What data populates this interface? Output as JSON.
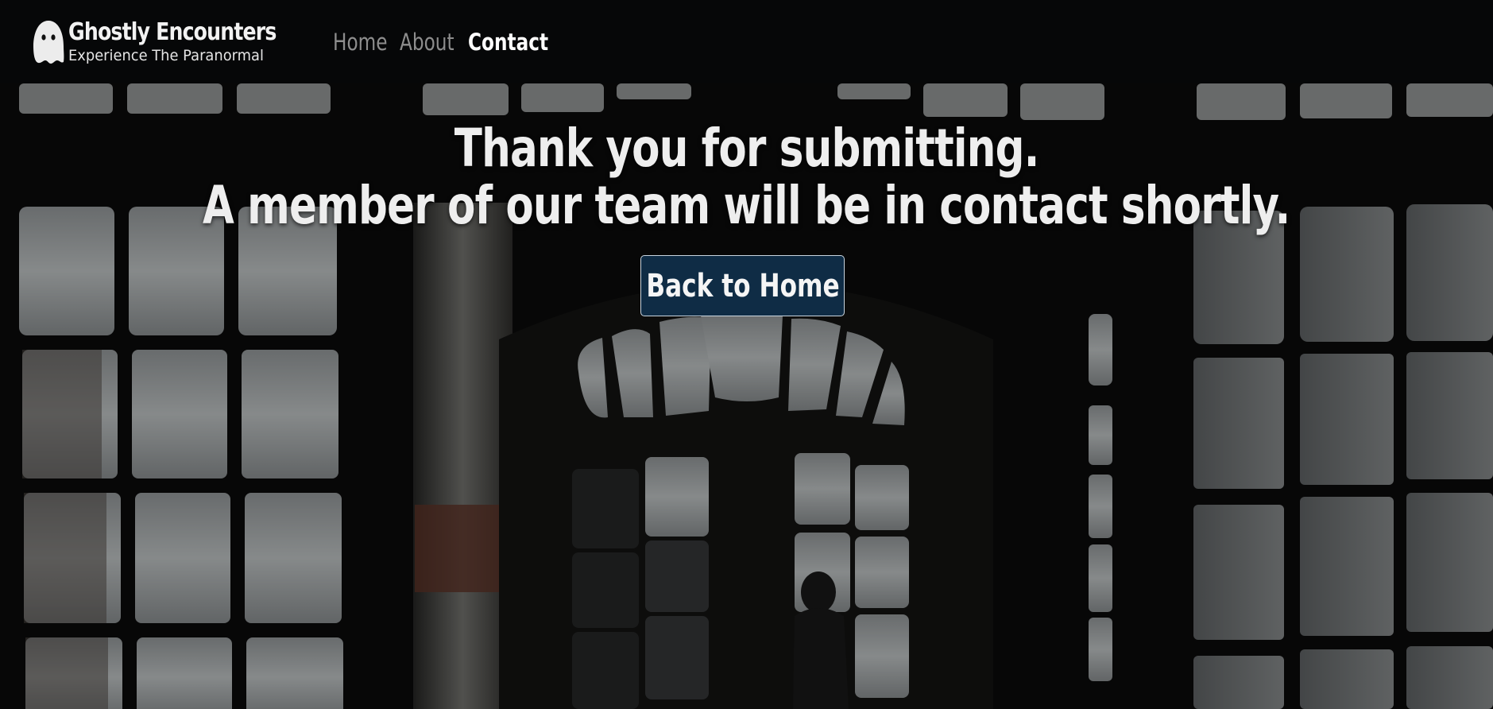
{
  "header": {
    "brand": {
      "title": "Ghostly Encounters",
      "subtitle": "Experience The Paranormal",
      "logo_icon": "ghost-icon"
    },
    "nav": [
      {
        "label": "Home",
        "state": "inactive"
      },
      {
        "label": "About",
        "state": "inactive"
      },
      {
        "label": "Contact",
        "state": "active"
      }
    ]
  },
  "hero": {
    "background": "haunted-room-with-windows-photo",
    "line1": "Thank you for submitting.",
    "line2": "A member of our team will be in contact shortly.",
    "button_label": "Back to Home"
  },
  "colors": {
    "header_bg": "#060708",
    "button_bg": "#0f2c45",
    "nav_inactive": "#8d8d8d",
    "nav_active": "#ffffff"
  }
}
